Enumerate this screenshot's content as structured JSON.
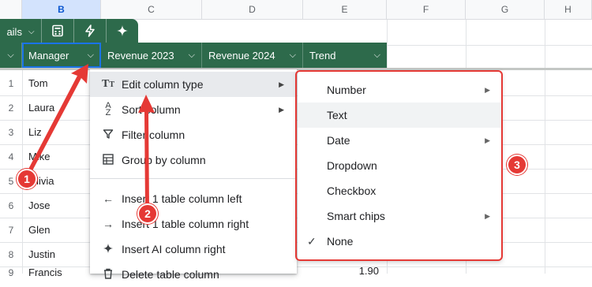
{
  "columns": {
    "b": "B",
    "c": "C",
    "d": "D",
    "e": "E",
    "f": "F",
    "g": "G",
    "h": "H"
  },
  "toolbar": {
    "partial_label": "ails",
    "calc_icon": "calculator-icon",
    "bolt_icon": "bolt-icon",
    "sparkle_icon": "sparkle-icon"
  },
  "table_headers": [
    {
      "label": "Manager"
    },
    {
      "label": "Revenue 2023"
    },
    {
      "label": "Revenue 2024"
    },
    {
      "label": "Trend"
    }
  ],
  "rows": [
    {
      "num": "1",
      "name": "Tom"
    },
    {
      "num": "2",
      "name": "Laura"
    },
    {
      "num": "3",
      "name": "Liz"
    },
    {
      "num": "4",
      "name": "Mike"
    },
    {
      "num": "5",
      "name": "Olivia"
    },
    {
      "num": "6",
      "name": "Jose"
    },
    {
      "num": "7",
      "name": "Glen"
    },
    {
      "num": "8",
      "name": "Justin"
    },
    {
      "num": "9",
      "name": "Francis"
    }
  ],
  "partial_value": "1.90",
  "context_menu": {
    "items": [
      {
        "label": "Edit column type",
        "icon": "text-type-icon",
        "has_sub": true
      },
      {
        "label": "Sort column",
        "icon": "sort-az-icon",
        "has_sub": true
      },
      {
        "label": "Filter column",
        "icon": "filter-icon",
        "has_sub": false
      },
      {
        "label": "Group by column",
        "icon": "group-table-icon",
        "has_sub": false
      },
      {
        "label": "Insert 1 table column left",
        "icon": "arrow-left-icon",
        "has_sub": false
      },
      {
        "label": "Insert 1 table column right",
        "icon": "arrow-right-icon",
        "has_sub": false
      },
      {
        "label": "Insert AI column right",
        "icon": "sparkle-icon",
        "has_sub": false
      },
      {
        "label": "Delete table column",
        "icon": "trash-icon",
        "has_sub": false
      }
    ]
  },
  "submenu": {
    "items": [
      {
        "label": "Number",
        "has_sub": true
      },
      {
        "label": "Text",
        "has_sub": false
      },
      {
        "label": "Date",
        "has_sub": true
      },
      {
        "label": "Dropdown",
        "has_sub": false
      },
      {
        "label": "Checkbox",
        "has_sub": false
      },
      {
        "label": "Smart chips",
        "has_sub": true
      },
      {
        "label": "None",
        "has_sub": false,
        "checked": true
      }
    ]
  },
  "annotations": {
    "one": "1",
    "two": "2",
    "three": "3"
  },
  "colors": {
    "table_green": "#2d6a4b",
    "annotation_red": "#e53935",
    "selection_blue": "#1a73e8"
  }
}
